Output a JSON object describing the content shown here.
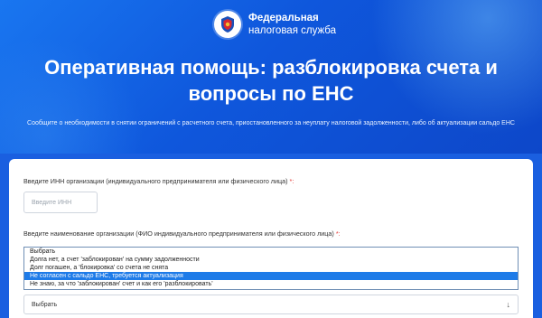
{
  "brand": {
    "line1": "Федеральная",
    "line2": "налоговая служба"
  },
  "hero": {
    "title": "Оперативная помощь: разблокировка счета и вопросы по ЕНС",
    "subtitle": "Сообщите о необходимости в снятии ограничений с расчетного счета, приостановленного за неуплату налоговой задолженности, либо об актуализации сальдо ЕНС"
  },
  "form": {
    "inn_label": "Введите ИНН организации (индивидуального предпринимателя или физического лица)",
    "inn_placeholder": "Введите ИНН",
    "required_mark": "*:",
    "name_label": "Введите наименование организации (ФИО индивидуального предпринимателя или физического лица)",
    "select_value": "Выбрать",
    "options": [
      "Выбрать",
      "Долга нет, а счет 'заблокирован' на сумму задолженности",
      "Долг погашен, а 'блокировка' со счета не снята",
      "Не согласен с сальдо ЕНС, требуется актуализация",
      "Не знаю, за что 'заблокирован' счет и как его 'разблокировать'"
    ],
    "highlighted_option_index": 3
  },
  "colors": {
    "hero_blue": "#0f57dc",
    "highlight": "#1e7be8",
    "required": "#e53935"
  }
}
